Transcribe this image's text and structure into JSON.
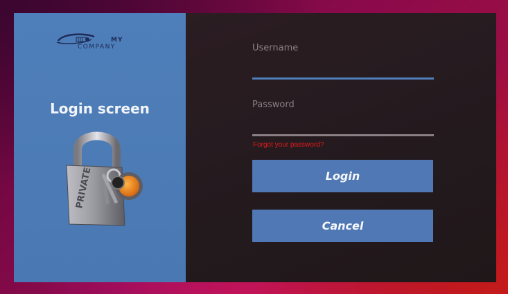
{
  "branding": {
    "logo_my": "MY",
    "logo_company": "COMPANY",
    "screen_title": "Login screen",
    "padlock_engraving": "PRIVATE"
  },
  "form": {
    "username_label": "Username",
    "username_value": "",
    "password_label": "Password",
    "password_value": "",
    "forgot_link": "Forgot your password?",
    "login_label": "Login",
    "cancel_label": "Cancel"
  },
  "colors": {
    "left_panel": "#4f7fba",
    "right_panel": "#231a1e",
    "button": "#4f78b4",
    "username_underline": "#4f7fba",
    "password_underline": "#8a7f83",
    "forgot_link": "#e31b1b"
  }
}
